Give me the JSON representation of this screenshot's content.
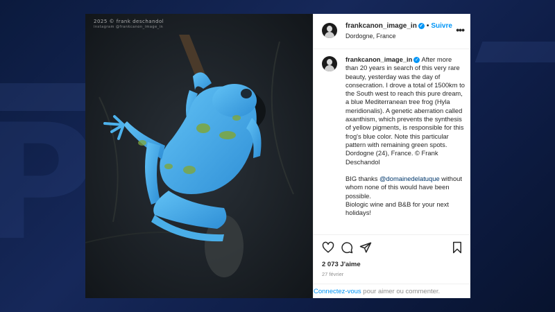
{
  "photo": {
    "watermark_line1": "2025 © frank deschandol",
    "watermark_line2": "instagram @frankcanon_image_in"
  },
  "header": {
    "username": "frankcanon_image_in",
    "separator": "•",
    "follow_label": "Suivre",
    "location": "Dordogne, France",
    "more_icon": "more-options-icon"
  },
  "caption": {
    "username": "frankcanon_image_in",
    "text_1": "After more than 20 years in search of this very rare beauty, yesterday was the day of consecration. I drove a total of 1500km to the South west to reach this pure dream, a blue Mediterranean tree frog (Hyla meridionalis). A genetic aberration called axanthism, which prevents the synthesis of yellow pigments, is responsible for this frog's blue color. Note this particular pattern with remaining green spots. Dordogne (24), France. © Frank Deschandol",
    "text_2_prefix": "BIG thanks",
    "mention": "@domainedelatuque",
    "text_2_suffix": "without whom none of this would have been possible.",
    "text_3": "Biologic wine and B&B for your next holidays!"
  },
  "actions": {
    "like_icon": "heart-icon",
    "comment_icon": "comment-icon",
    "share_icon": "send-icon",
    "save_icon": "bookmark-icon"
  },
  "likes_text": "2 073 J'aime",
  "date_text": "27 février",
  "login_bar": {
    "link_text": "Connectez-vous",
    "rest_text": "pour aimer ou commenter."
  },
  "colors": {
    "accent": "#0095f6",
    "frog_blue": "#3fa7e6",
    "background": "#0e1d46"
  }
}
